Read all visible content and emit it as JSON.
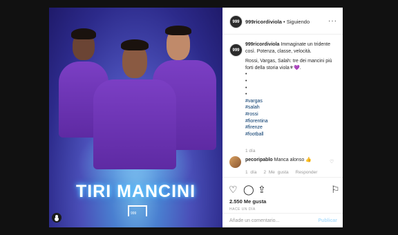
{
  "header": {
    "avatar_text": "999",
    "username": "999ricordiviola",
    "separator": " • ",
    "follow_status": "Siguiendo",
    "more_icon": "more-dots-icon"
  },
  "photo": {
    "title": "TIRI MANCINI",
    "logo_label": "999"
  },
  "caption": {
    "username": "999ricordiviola",
    "text": "Immaginate un tridente così. Potenza, classe, velocità.",
    "text2": "Rossi, Vargas, Salah: tre dei mancini più forti della storia viola⚜💜.",
    "bullets": [
      "•",
      "•",
      "•",
      "•"
    ],
    "hashtags": [
      "#vargas",
      "#salah",
      "#rossi",
      "#fiorentina",
      "#firenze",
      "#football"
    ],
    "time": "1 día"
  },
  "comment": {
    "username": "pecoripablo",
    "text": "Manca alonso 👍",
    "time": "1 día",
    "likes": "2 Me gusta",
    "reply": "Responder"
  },
  "stats": {
    "likes": "2.550 Me gusta",
    "date": "HACE UN DÍA"
  },
  "add_comment": {
    "placeholder": "Añade un comentario...",
    "publish": "Publicar"
  }
}
